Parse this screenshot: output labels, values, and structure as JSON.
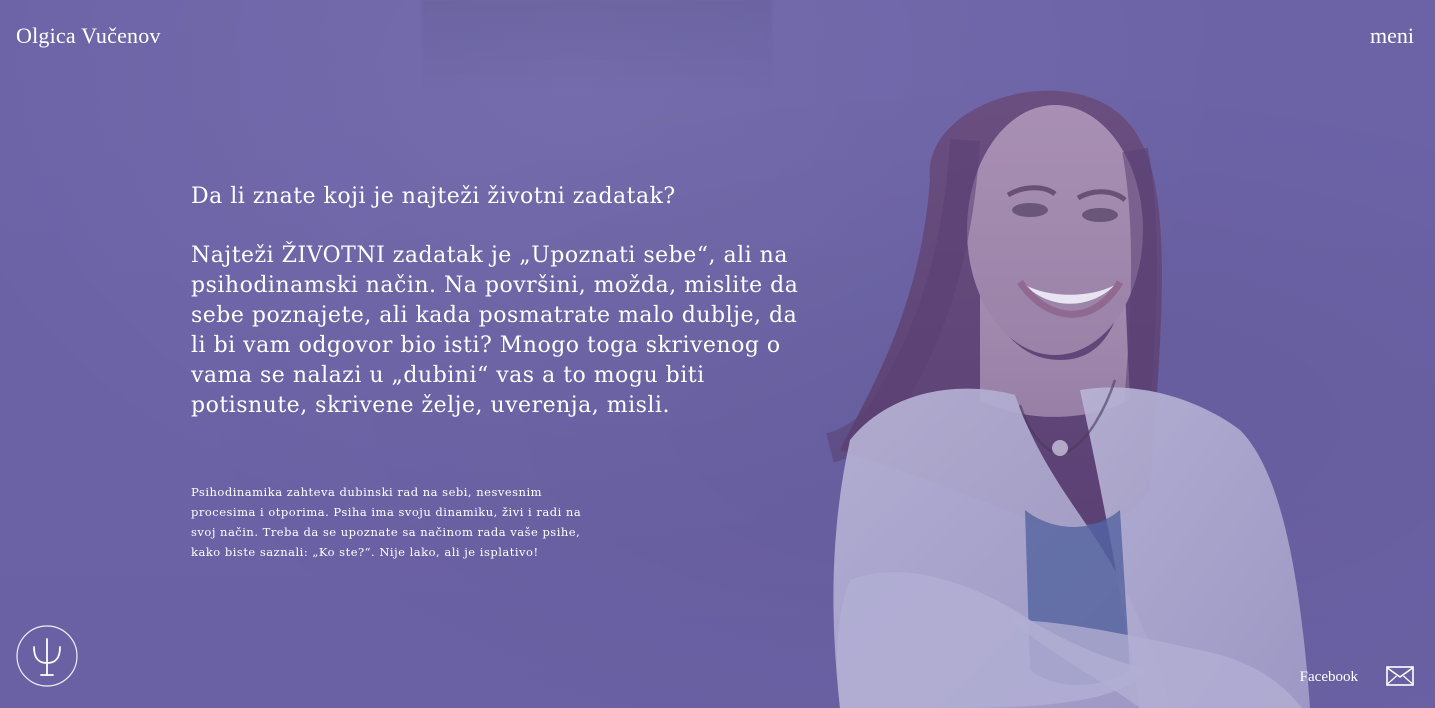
{
  "header": {
    "brand": "Olgica Vučenov",
    "menu_label": "meni"
  },
  "main": {
    "question": "Da li znate koji je najteži životni zadatak?",
    "lead": "Najteži ŽIVOTNI zadatak je „Upoznati sebe“, ali na psihodinamski način. Na površini, možda, mislite da sebe poznajete, ali kada posmatrate malo dublje, da li bi vam odgovor bio isti? Mnogo toga skrivenog o vama se nalazi u „dubini“ vas a to mogu biti potisnute, skrivene želje, uverenja, misli.",
    "small": "Psihodinamika zahteva dubinski rad na sebi, nesvesnim procesima i otporima. Psiha ima svoju dinamiku, živi i radi na svoj način. Treba da se upoznate sa načinom rada vaše psihe, kako biste saznali: „Ko ste?“. Nije lako, ali je isplativo!"
  },
  "footer": {
    "facebook_label": "Facebook"
  },
  "icons": {
    "logo": "psi-circle-logo-icon",
    "mail": "envelope-icon"
  },
  "colors": {
    "overlay": "#6b62a6",
    "text": "#ffffff"
  }
}
